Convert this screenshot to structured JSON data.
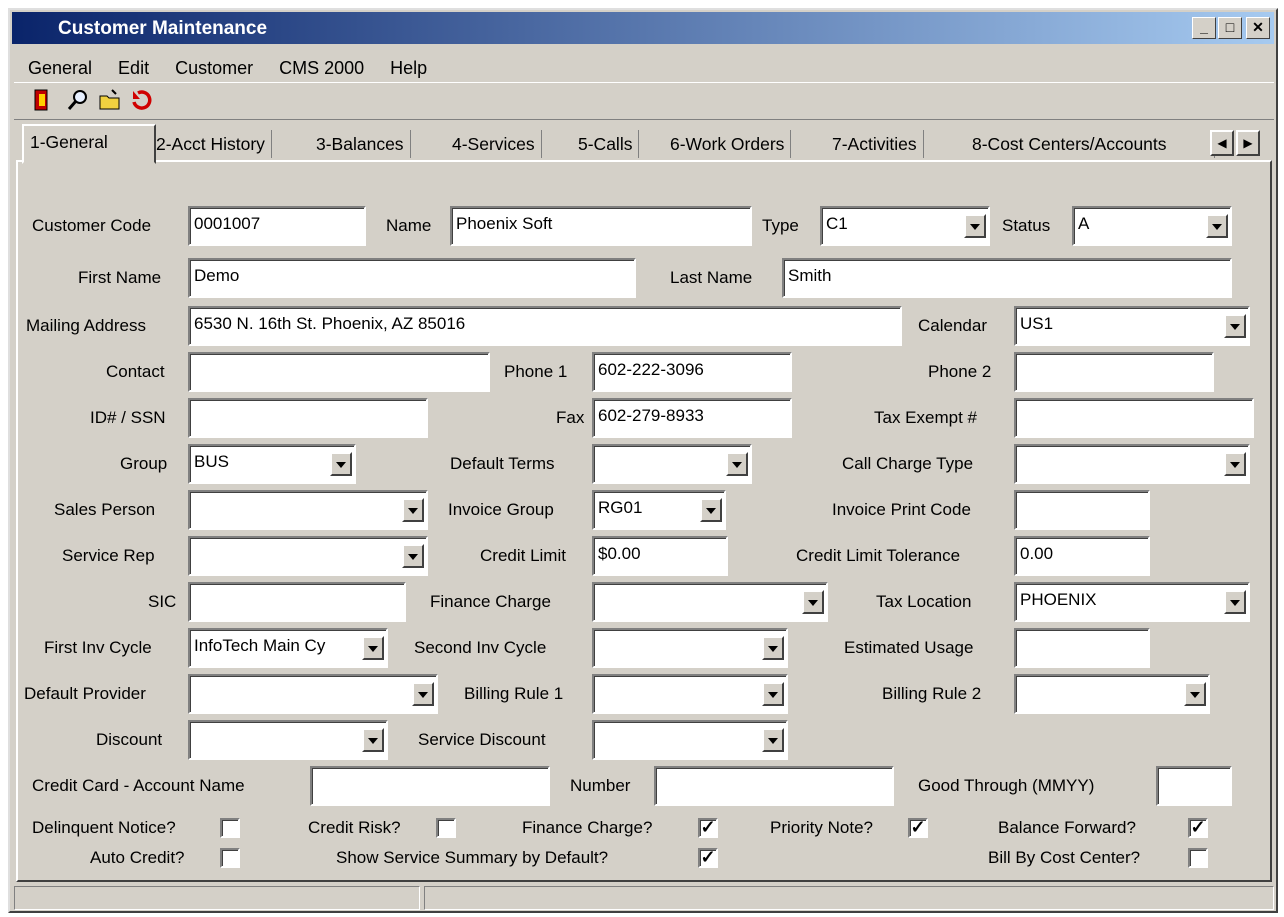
{
  "window": {
    "title": "Customer Maintenance"
  },
  "menu": [
    "General",
    "Edit",
    "Customer",
    "CMS 2000",
    "Help"
  ],
  "toolbar": [
    "exit-icon",
    "search-icon",
    "open-folder-icon",
    "refresh-icon"
  ],
  "tabs": [
    "1-General",
    "2-Acct History",
    "3-Balances",
    "4-Services",
    "5-Calls",
    "6-Work Orders",
    "7-Activities",
    "8-Cost Centers/Accounts"
  ],
  "form": {
    "customer_code_label": "Customer Code",
    "customer_code": "0001007",
    "name_label": "Name",
    "name": "Phoenix Soft",
    "type_label": "Type",
    "type": "C1",
    "status_label": "Status",
    "status": "A",
    "first_name_label": "First Name",
    "first_name": "Demo",
    "last_name_label": "Last Name",
    "last_name": "Smith",
    "mailing_label": "Mailing Address",
    "mailing": "6530 N. 16th St. Phoenix, AZ 85016",
    "calendar_label": "Calendar",
    "calendar": "US1",
    "contact_label": "Contact",
    "contact": "",
    "phone1_label": "Phone 1",
    "phone1": "602-222-3096",
    "phone2_label": "Phone 2",
    "phone2": "",
    "id_label": "ID# / SSN",
    "id": "",
    "fax_label": "Fax",
    "fax": "602-279-8933",
    "tax_exempt_label": "Tax Exempt #",
    "tax_exempt": "",
    "group_label": "Group",
    "group": "BUS",
    "default_terms_label": "Default Terms",
    "default_terms": "",
    "call_charge_label": "Call Charge Type",
    "call_charge": "",
    "sales_person_label": "Sales Person",
    "sales_person": "",
    "invoice_group_label": "Invoice Group",
    "invoice_group": "RG01",
    "invoice_print_label": "Invoice Print Code",
    "invoice_print": "",
    "service_rep_label": "Service Rep",
    "service_rep": "",
    "credit_limit_label": "Credit Limit",
    "credit_limit": "$0.00",
    "credit_tol_label": "Credit Limit Tolerance",
    "credit_tol": "0.00",
    "sic_label": "SIC",
    "sic": "",
    "finance_charge_label": "Finance Charge",
    "finance_charge": "",
    "tax_location_label": "Tax Location",
    "tax_location": "PHOENIX",
    "first_inv_label": "First Inv Cycle",
    "first_inv": "InfoTech Main Cy",
    "second_inv_label": "Second Inv Cycle",
    "second_inv": "",
    "est_usage_label": "Estimated Usage",
    "est_usage": "",
    "default_provider_label": "Default Provider",
    "default_provider": "",
    "billing1_label": "Billing Rule 1",
    "billing1": "",
    "billing2_label": "Billing Rule 2",
    "billing2": "",
    "discount_label": "Discount",
    "discount": "",
    "service_discount_label": "Service Discount",
    "service_discount": "",
    "cc_name_label": "Credit Card - Account Name",
    "cc_name": "",
    "number_label": "Number",
    "number": "",
    "good_through_label": "Good Through (MMYY)",
    "good_through": ""
  },
  "checks": {
    "delinquent_label": "Delinquent Notice?",
    "delinquent": false,
    "credit_risk_label": "Credit Risk?",
    "credit_risk": false,
    "finance_label": "Finance Charge?",
    "finance": true,
    "priority_label": "Priority Note?",
    "priority": true,
    "balance_label": "Balance Forward?",
    "balance": true,
    "auto_credit_label": "Auto Credit?",
    "auto_credit": false,
    "show_summary_label": "Show Service Summary by Default?",
    "show_summary": true,
    "bill_cost_label": "Bill By Cost Center?",
    "bill_cost": false
  },
  "check_mark": "✓"
}
